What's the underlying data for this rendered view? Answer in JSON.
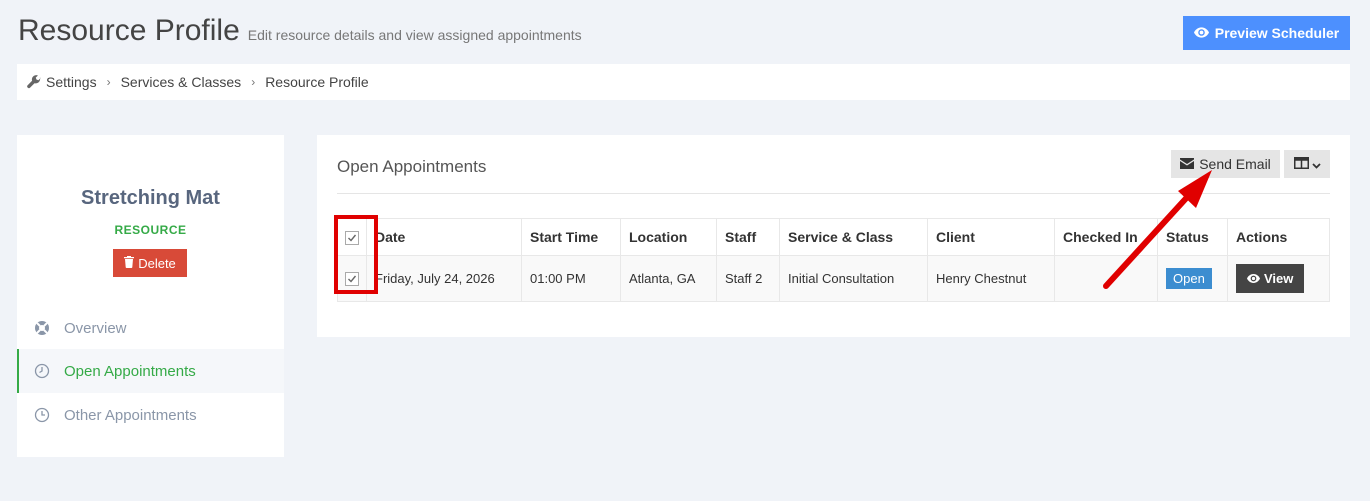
{
  "header": {
    "title": "Resource Profile",
    "subtitle": "Edit resource details and view assigned appointments",
    "preview_button": "Preview Scheduler"
  },
  "breadcrumb": [
    "Settings",
    "Services & Classes",
    "Resource Profile"
  ],
  "resource": {
    "name": "Stretching Mat",
    "type": "RESOURCE",
    "delete_label": "Delete"
  },
  "nav": [
    {
      "label": "Overview",
      "icon": "lifebuoy-icon",
      "active": false
    },
    {
      "label": "Open Appointments",
      "icon": "clock-icon",
      "active": true
    },
    {
      "label": "Other Appointments",
      "icon": "history-icon",
      "active": false
    }
  ],
  "appointments": {
    "title": "Open Appointments",
    "send_email_label": "Send Email",
    "columns": [
      "Date",
      "Start Time",
      "Location",
      "Staff",
      "Service & Class",
      "Client",
      "Checked In",
      "Status",
      "Actions"
    ],
    "rows": [
      {
        "checked": true,
        "date": "Friday, July 24, 2026",
        "start_time": "01:00 PM",
        "location": "Atlanta, GA",
        "staff": "Staff 2",
        "service": "Initial Consultation",
        "client": "Henry Chestnut",
        "checked_in": "",
        "status": "Open",
        "action_label": "View"
      }
    ]
  },
  "colors": {
    "primary": "#4d90fe",
    "success": "#35aa47",
    "danger": "#d84a38",
    "annotation": "#e00000"
  }
}
